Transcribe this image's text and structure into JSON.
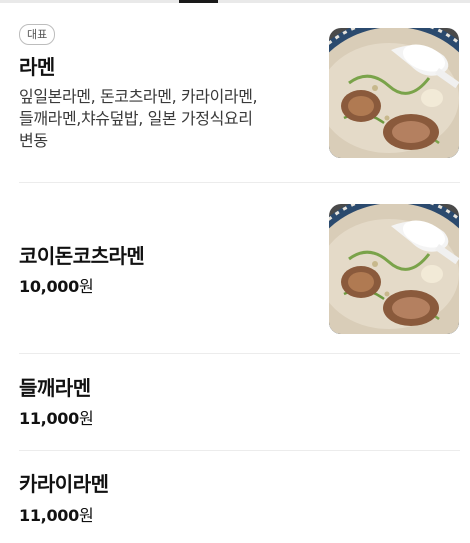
{
  "menu": {
    "items": [
      {
        "badge": "대표",
        "name": "라멘",
        "desc_lines": [
          "잎일본라멘, 돈코츠라멘, 카라이라멘,",
          "들깨라멘,챠슈덮밥, 일본 가정식요리",
          "변동"
        ],
        "image_icon": "ramen-photo"
      },
      {
        "name": "코이돈코츠라멘",
        "price": "10,000",
        "unit": "원",
        "image_icon": "ramen-photo"
      },
      {
        "name": "들깨라멘",
        "price": "11,000",
        "unit": "원"
      },
      {
        "name": "카라이라멘",
        "price": "11,000",
        "unit": "원"
      }
    ]
  },
  "colors": {
    "divider": "#ececec",
    "badge_border": "#bdbdbd",
    "broth": "#d9cdb8",
    "bowl_rim": "#2b4a6e",
    "chashu": "#8a5a3c"
  }
}
